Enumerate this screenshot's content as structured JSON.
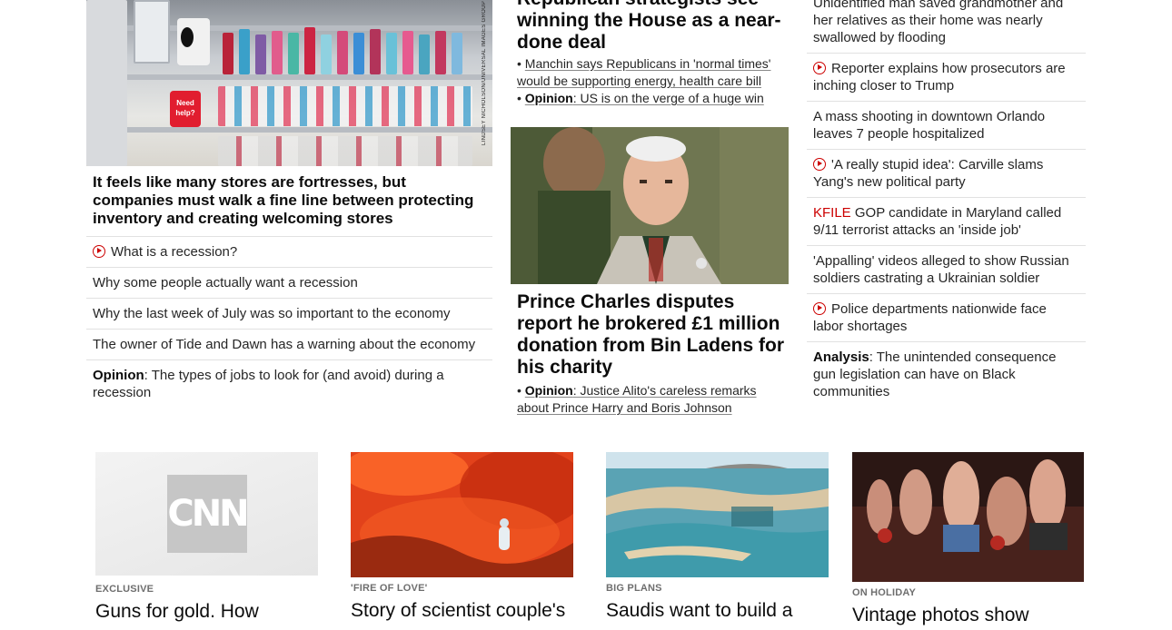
{
  "left": {
    "photo_credit": "LINDSEY NICHOLSON/UNIVERSAL IMAGES GROUP",
    "sign_text": "Need help?",
    "headline": "It feels like many stores are fortresses, but companies must walk a fine line between protecting inventory and creating welcoming stores",
    "items": [
      {
        "label": "What is a recession?",
        "video": true
      },
      {
        "label": "Why some people actually want a recession",
        "video": false
      },
      {
        "label": "Why the last week of July was so important to the economy",
        "video": false
      },
      {
        "label": "The owner of Tide and Dawn has a warning about the economy",
        "video": false
      }
    ],
    "opinion_item": {
      "prefix": "Opinion",
      "rest": ": The types of jobs to look for (and avoid) during a recession"
    }
  },
  "middle": {
    "top_headline": "Republican strategists see winning the House as a near-done deal",
    "bullet1": "Manchin says Republicans in 'normal times' would be supporting energy, health care bill",
    "bullet2_prefix": "Opinion",
    "bullet2_rest": ": US is on the verge of a huge win",
    "headline": "Prince Charles disputes report he brokered £1 million donation from Bin Ladens for his charity",
    "bullet3_prefix": "Opinion",
    "bullet3_rest": ": Justice Alito's careless remarks about Prince Harry and Boris Johnson"
  },
  "right": {
    "items": [
      {
        "label": "Unidentified man saved grandmother and her relatives as their home was nearly swallowed by flooding",
        "video": false
      },
      {
        "label": "Reporter explains how prosecutors are inching closer to Trump",
        "video": true
      },
      {
        "label": "A mass shooting in downtown Orlando leaves 7 people hospitalized",
        "video": false
      },
      {
        "label": "'A really stupid idea': Carville slams Yang's new political party",
        "video": true
      }
    ],
    "kfile_item": {
      "prefix": "KFILE",
      "rest": " GOP candidate in Maryland called 9/11 terrorist attacks an 'inside job'"
    },
    "items2": [
      {
        "label": "'Appalling' videos alleged to show Russian soldiers castrating a Ukrainian soldier",
        "video": false
      },
      {
        "label": "Police departments nationwide face labor shortages",
        "video": true
      }
    ],
    "analysis_item": {
      "prefix": "Analysis",
      "rest": ": The unintended consequence gun legislation can have on Black communities"
    }
  },
  "cards": [
    {
      "kicker": "EXCLUSIVE",
      "title": "Guns for gold. How",
      "logo": "CNN"
    },
    {
      "kicker": "'FIRE OF LOVE'",
      "title": "Story of scientist couple's"
    },
    {
      "kicker": "BIG PLANS",
      "title": "Saudis want to build a"
    },
    {
      "kicker": "ON HOLIDAY",
      "title": "Vintage photos show"
    }
  ],
  "colors": {
    "accent_red": "#cc0000",
    "text": "#0c0c0c",
    "divider": "#e1e1e1",
    "kicker": "#6e6e6e"
  }
}
